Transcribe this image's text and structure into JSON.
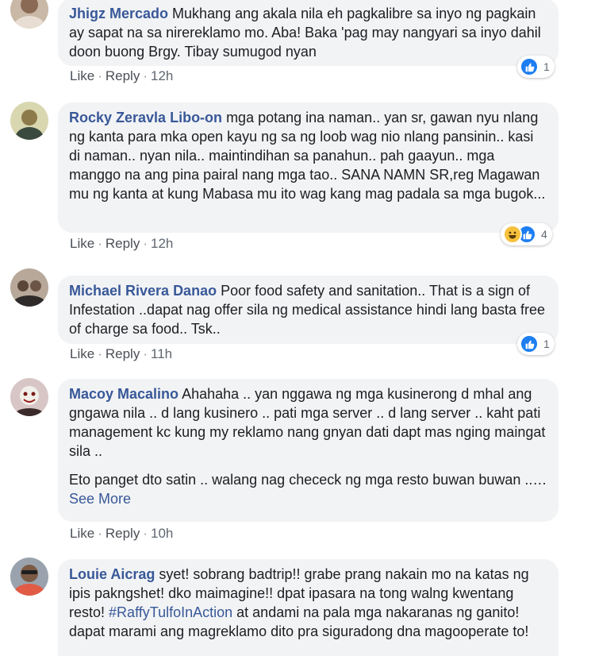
{
  "actions": {
    "like": "Like",
    "reply": "Reply",
    "separator": "·"
  },
  "comments": [
    {
      "author": "Jhigz Mercado",
      "text": "Mukhang ang akala nila eh pagkalibre sa inyo ng pagkain ay sapat na sa nirereklamo mo. Aba! Baka 'pag may nangyari sa inyo dahil doon buong Brgy. Tibay sumugod nyan",
      "time": "12h",
      "reaction_count": "1",
      "reaction_icons": [
        "like-icon"
      ]
    },
    {
      "author": "Rocky Zeravla Libo-on",
      "text": "mga potang ina naman.. yan sr, gawan nyu nlang ng kanta para mka open kayu ng sa ng loob wag nio nlang pansinin.. kasi di naman.. nyan nila.. maintindihan sa panahun.. pah gaayun.. mga manggo na ang pina pairal nang mga tao.. SANA NAMN SR,reg Magawan mu ng kanta at kung Mabasa mu ito wag kang mag padala sa mga bugok...",
      "time": "12h",
      "reaction_count": "4",
      "reaction_icons": [
        "haha-icon",
        "like-icon"
      ]
    },
    {
      "author": "Michael Rivera Danao",
      "text": "Poor food safety and sanitation.. That is a sign of Infestation ..dapat nag offer sila ng medical assistance hindi lang basta free of charge sa food.. Tsk..",
      "time": "11h",
      "reaction_count": "1",
      "reaction_icons": [
        "like-icon"
      ]
    },
    {
      "author": "Macoy Macalino",
      "text": "Ahahaha .. yan nggawa ng mga kusinerong d mhal ang gngawa nila .. d lang kusinero .. pati mga server .. d lang server .. kaht pati management kc kung my reklamo nang gnyan dati dapt mas nging maingat sila ..",
      "text2": "Eto panget dto satin .. walang nag chececk ng mga resto buwan buwan ..…",
      "see_more": "See More",
      "time": "10h"
    },
    {
      "author": "Louie Aicrag",
      "text": "syet! sobrang badtrip!! grabe prang nakain mo na katas ng ipis pakngshet! dko maimagine!! dpat ipasara na tong walng kwentang resto!",
      "hashtag": "#RaffyTulfoInAction",
      "text_after": "at andami na pala mga nakaranas ng ganito! dapat marami ang magreklamo dito pra siguradong dna magooperate to!"
    }
  ]
}
